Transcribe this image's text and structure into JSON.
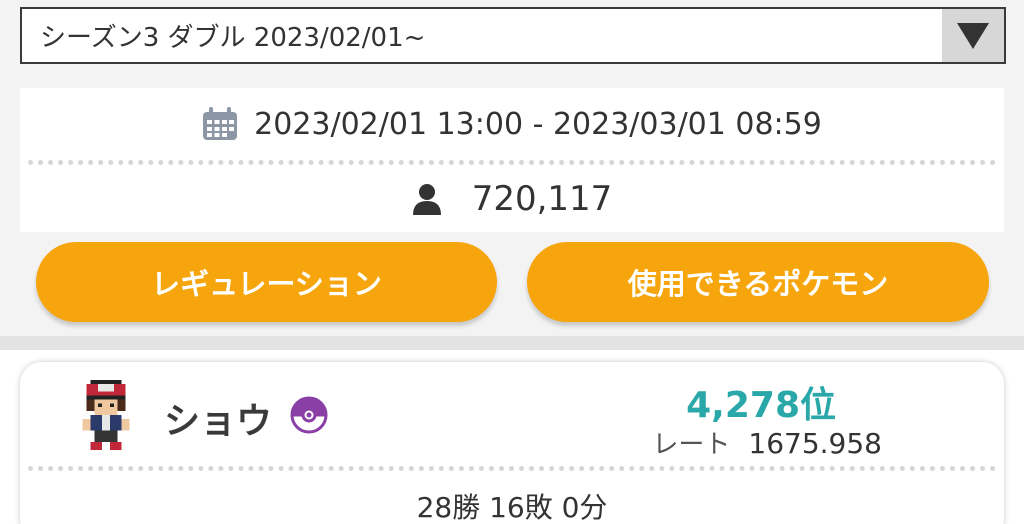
{
  "season_select": {
    "value": "シーズン3 ダブル 2023/02/01~"
  },
  "season_info": {
    "period": "2023/02/01 13:00 - 2023/03/01 08:59",
    "participants": "720,117"
  },
  "buttons": {
    "regulation": "レギュレーション",
    "usable_pokemon": "使用できるポケモン"
  },
  "player": {
    "name": "ショウ",
    "rank": "4,278位",
    "rate_label": "レート",
    "rate_value": "1675.958",
    "record": "28勝 16敗 0分"
  },
  "icons": {
    "dropdown": "triangle-down-icon",
    "calendar": "calendar-icon",
    "user": "user-icon",
    "ball": "master-ball-icon"
  },
  "colors": {
    "accent_orange": "#f7a50d",
    "rank_teal": "#2aa7a8",
    "ball_purple": "#8a3fa6"
  }
}
